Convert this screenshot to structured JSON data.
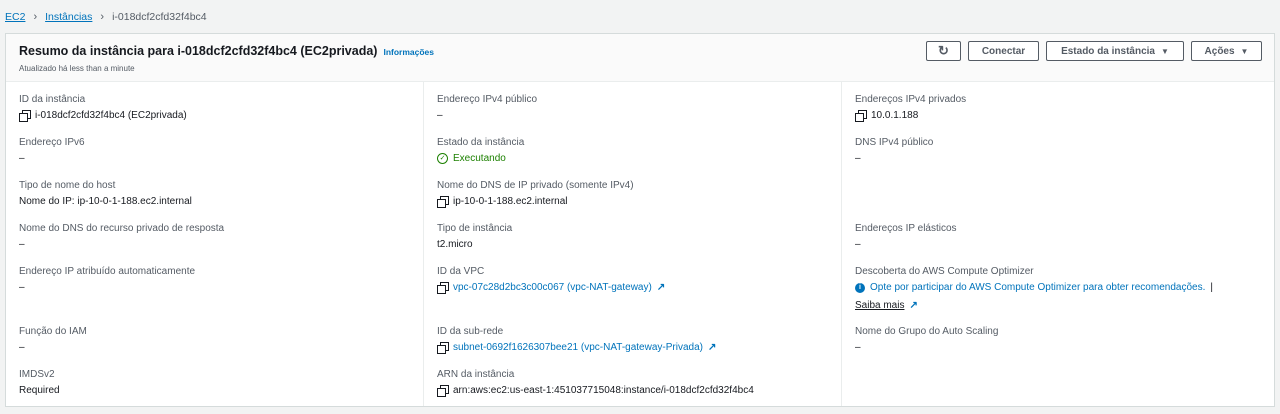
{
  "breadcrumb": {
    "items": [
      "EC2",
      "Instâncias"
    ],
    "current": "i-018dcf2cfd32f4bc4"
  },
  "header": {
    "title": "Resumo da instância para i-018dcf2cfd32f4bc4 (EC2privada)",
    "info_link": "Informações",
    "subtitle": "Atualizado há less than a minute",
    "buttons": {
      "connect": "Conectar",
      "instance_state": "Estado da instância",
      "actions": "Ações"
    }
  },
  "fields": {
    "instance_id": {
      "label": "ID da instância",
      "value": "i-018dcf2cfd32f4bc4 (EC2privada)"
    },
    "ipv6": {
      "label": "Endereço IPv6",
      "value": "–"
    },
    "hostname_type": {
      "label": "Tipo de nome do host",
      "value": "Nome do IP: ip-10-0-1-188.ec2.internal"
    },
    "private_dns_response": {
      "label": "Nome do DNS do recurso privado de resposta",
      "value": "–"
    },
    "auto_ip": {
      "label": "Endereço IP atribuído automaticamente",
      "value": "–"
    },
    "iam_role": {
      "label": "Função do IAM",
      "value": "–"
    },
    "imdsv2": {
      "label": "IMDSv2",
      "value": "Required"
    },
    "public_ipv4": {
      "label": "Endereço IPv4 público",
      "value": "–"
    },
    "instance_state": {
      "label": "Estado da instância",
      "value": "Executando"
    },
    "private_dns": {
      "label": "Nome do DNS de IP privado (somente IPv4)",
      "value": "ip-10-0-1-188.ec2.internal"
    },
    "instance_type": {
      "label": "Tipo de instância",
      "value": "t2.micro"
    },
    "vpc_id": {
      "label": "ID da VPC",
      "value": "vpc-07c28d2bc3c00c067 (vpc-NAT-gateway)"
    },
    "subnet_id": {
      "label": "ID da sub-rede",
      "value": "subnet-0692f1626307bee21 (vpc-NAT-gateway-Privada)"
    },
    "arn": {
      "label": "ARN da instância",
      "value": "arn:aws:ec2:us-east-1:451037715048:instance/i-018dcf2cfd32f4bc4"
    },
    "private_ipv4": {
      "label": "Endereços IPv4 privados",
      "value": "10.0.1.188"
    },
    "public_dns": {
      "label": "DNS IPv4 público",
      "value": "–"
    },
    "elastic_ip": {
      "label": "Endereços IP elásticos",
      "value": "–"
    },
    "optimizer": {
      "label": "Descoberta do AWS Compute Optimizer",
      "value": "Opte por participar do AWS Compute Optimizer para obter recomendações.",
      "pipe": "|",
      "learn_more": "Saiba mais"
    },
    "asg": {
      "label": "Nome do Grupo do Auto Scaling",
      "value": "–"
    }
  },
  "colors": {
    "link": "#0073bb",
    "success": "#1d8102",
    "border": "#d5dbdb"
  }
}
